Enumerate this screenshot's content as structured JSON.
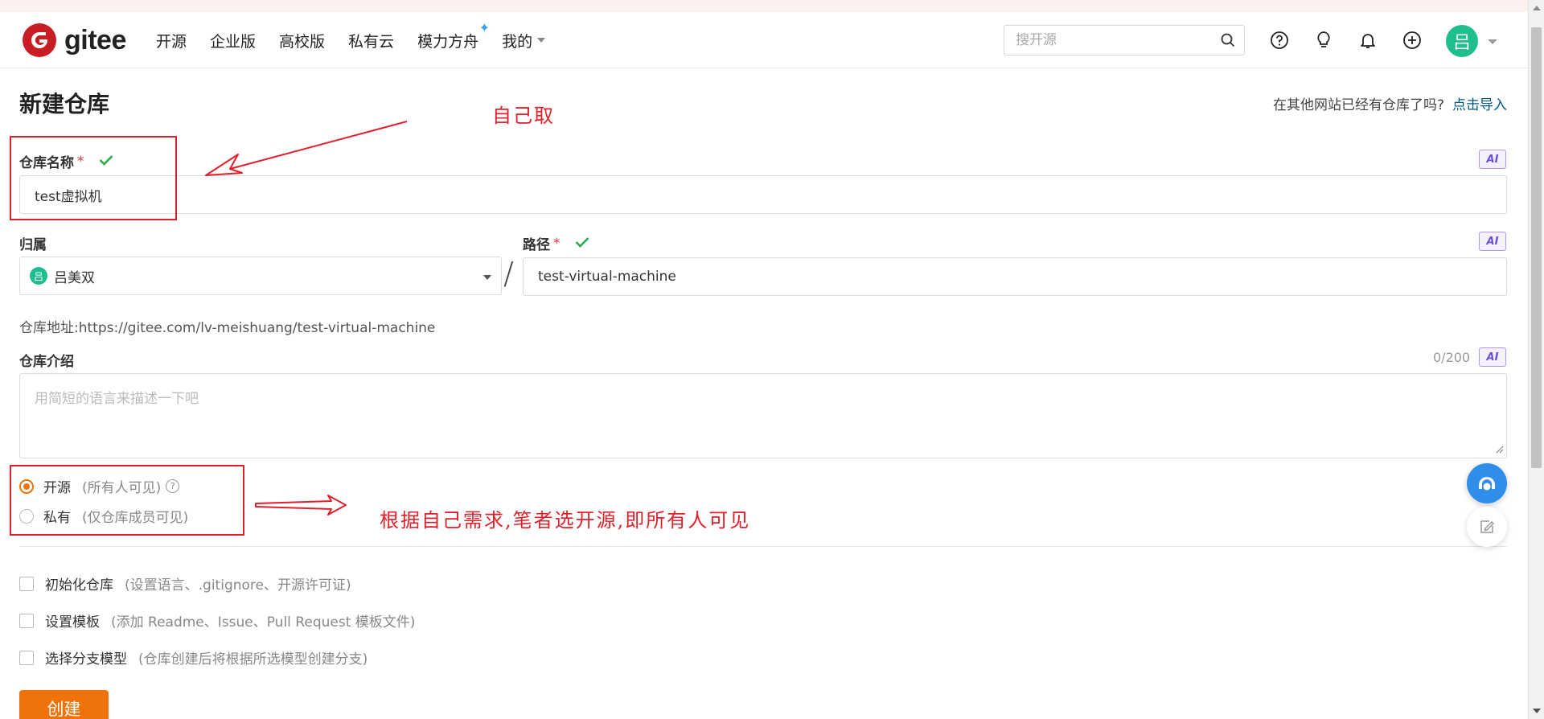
{
  "header": {
    "logo_text": "gitee",
    "nav": [
      "开源",
      "企业版",
      "高校版",
      "私有云",
      "模力方舟",
      "我的"
    ],
    "search_placeholder": "搜开源",
    "user_avatar_char": "吕"
  },
  "page": {
    "title": "新建仓库",
    "import_prompt": "在其他网站已经有仓库了吗?",
    "import_link": "点击导入"
  },
  "form": {
    "name_label": "仓库名称",
    "required_mark": "*",
    "name_value": "test虚拟机",
    "ai_label": "AI",
    "owner_label": "归属",
    "owner_avatar_char": "吕",
    "owner_value": "吕美双",
    "slash": "/",
    "path_label": "路径",
    "path_value": "test-virtual-machine",
    "repo_url_label": "仓库地址:",
    "repo_url": "https://gitee.com/lv-meishuang/test-virtual-machine",
    "intro_label": "仓库介绍",
    "intro_counter": "0/200",
    "intro_placeholder": "用简短的语言来描述一下吧",
    "visibility": [
      {
        "label": "开源",
        "hint": "(所有人可见)",
        "checked": true
      },
      {
        "label": "私有",
        "hint": "(仅仓库成员可见)",
        "checked": false
      }
    ],
    "options": [
      {
        "label": "初始化仓库",
        "hint": "(设置语言、.gitignore、开源许可证)"
      },
      {
        "label": "设置模板",
        "hint": "(添加 Readme、Issue、Pull Request 模板文件)"
      },
      {
        "label": "选择分支模型",
        "hint": "(仓库创建后将根据所选模型创建分支)"
      }
    ],
    "create_button": "创建"
  },
  "annotations": {
    "name_note": "自己取",
    "visibility_note": "根据自己需求,笔者选开源,即所有人可见",
    "color": "#e0202a"
  },
  "colors": {
    "brand": "#c71d23",
    "accent": "#f0720b",
    "link": "#005980",
    "success": "#2eaa4f",
    "avatar": "#1ebe8f"
  }
}
